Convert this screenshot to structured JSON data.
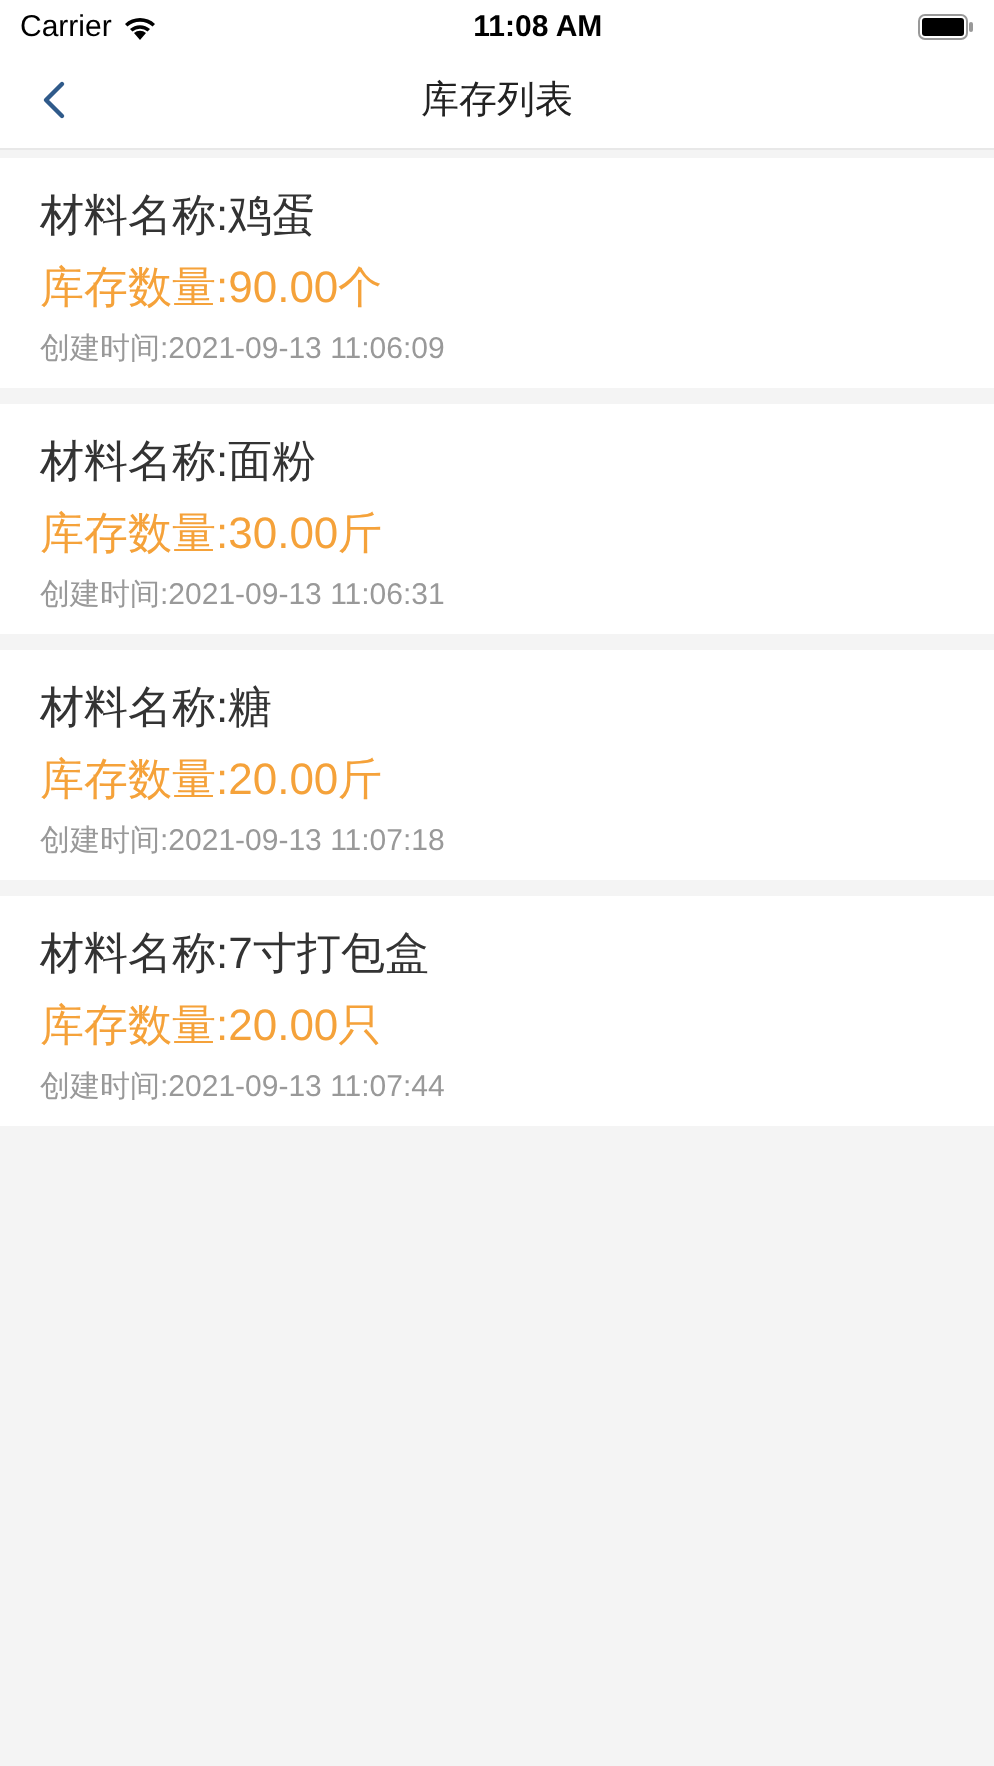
{
  "status_bar": {
    "carrier": "Carrier",
    "time": "11:08 AM"
  },
  "nav": {
    "title": "库存列表"
  },
  "items": [
    {
      "name": "材料名称:鸡蛋",
      "quantity": "库存数量:90.00个",
      "created": "创建时间:2021-09-13 11:06:09"
    },
    {
      "name": "材料名称:面粉",
      "quantity": "库存数量:30.00斤",
      "created": "创建时间:2021-09-13 11:06:31"
    },
    {
      "name": "材料名称:糖",
      "quantity": "库存数量:20.00斤",
      "created": "创建时间:2021-09-13 11:07:18"
    },
    {
      "name": "材料名称:7寸打包盒",
      "quantity": "库存数量:20.00只",
      "created": "创建时间:2021-09-13 11:07:44"
    }
  ]
}
